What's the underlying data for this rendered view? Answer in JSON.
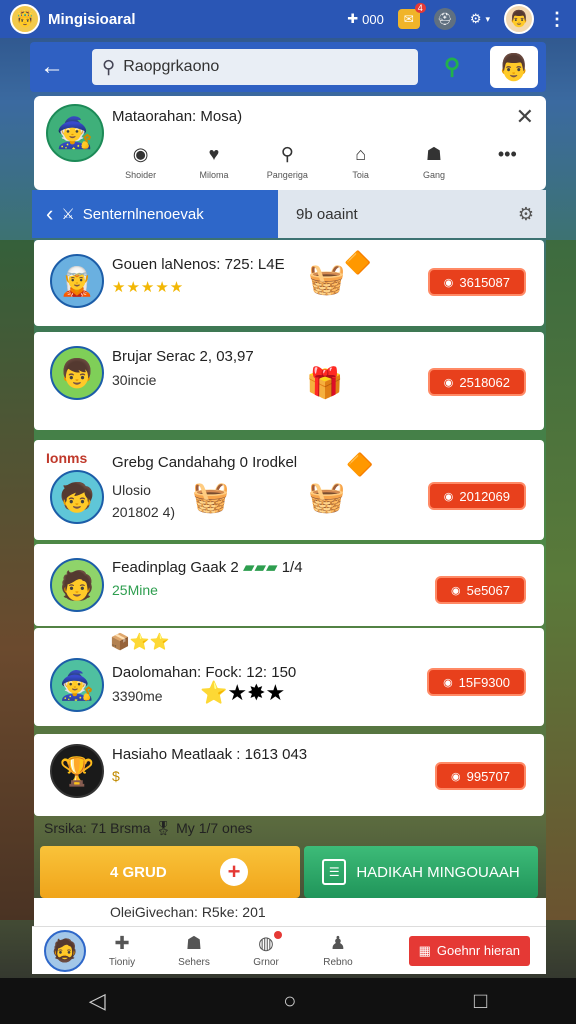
{
  "topbar": {
    "title": "Mingisioaral",
    "count_label": "000",
    "notif_badge": "4"
  },
  "search": {
    "value": "Raopgrkaono"
  },
  "profile_card": {
    "name": "Mataorahan: Mosa)",
    "tabs": [
      {
        "label": "Shoider"
      },
      {
        "label": "Miloma"
      },
      {
        "label": "Pangeriga"
      },
      {
        "label": "Toia"
      },
      {
        "label": "Gang"
      }
    ]
  },
  "filter": {
    "left_label": "Senternlnenoevak",
    "right_label": "9b oaaint"
  },
  "rows": [
    {
      "title": "Gouen laNenos: 725: L4E",
      "sub": "★★★★★",
      "price": "3615087"
    },
    {
      "title": "Brujar Serac 2, 03,97",
      "sub": "30incie",
      "price": "2518062"
    },
    {
      "title": "Grebg Candahahg 0 Irodkel",
      "sub": "Ulosio",
      "sub2": "201802 4)",
      "price": "2012069",
      "corner": "Ionms"
    },
    {
      "title": "Feadinplag Gaak 2",
      "title_extra": "1/4",
      "sub": "25Mine",
      "price": "5e5067"
    },
    {
      "title": "Daolomahan: Fock: 12: 150",
      "sub": "3390me",
      "price": "15F9300"
    },
    {
      "title": "Hasiaho Meatlaak : 1613 043",
      "sub": "$",
      "price": "995707"
    }
  ],
  "summary": "Srsika: 71 Brsma 🎖 My 1/7 ones",
  "actions": {
    "yellow_label": "4 GRUD",
    "green_label": "HADIKAH MINGOUAAH"
  },
  "partial_row": "OleiGivechan: R5ke: 201",
  "bottomnav": {
    "items": [
      {
        "label": "Tioniy"
      },
      {
        "label": "Sehers"
      },
      {
        "label": "Grnor"
      },
      {
        "label": "Rebno"
      }
    ],
    "red_label": "Goehnr hieran"
  }
}
